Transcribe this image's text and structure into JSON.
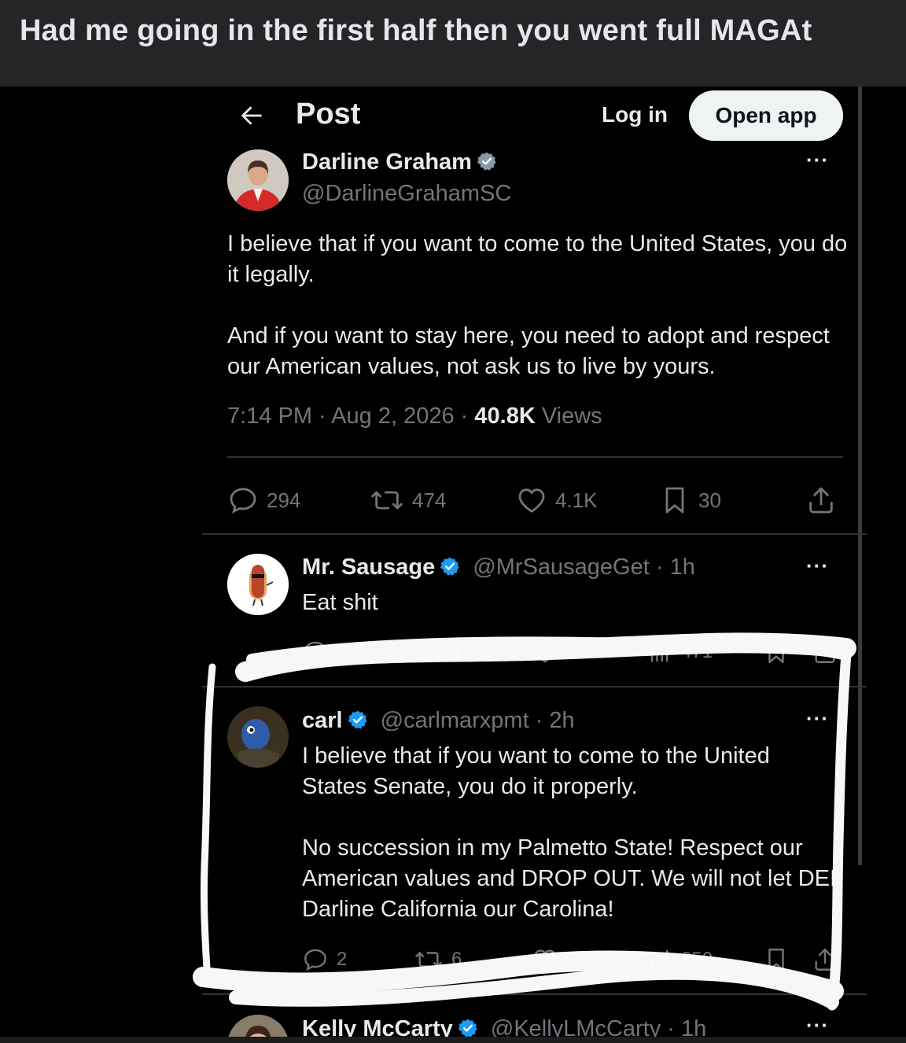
{
  "caption": "Had me going in the first half then you went full MAGAt",
  "header": {
    "title": "Post",
    "login_label": "Log in",
    "open_app_label": "Open app"
  },
  "main_post": {
    "name": "Darline Graham",
    "handle": "@DarlineGrahamSC",
    "paragraphs": [
      "I believe that if you want to come to the United States, you do it legally.",
      "And if you want to stay here, you need to adopt and respect our American values, not ask us to live by yours."
    ],
    "time": "7:14 PM",
    "date": "Aug 2, 2026",
    "views_count": "40.8K",
    "views_label": "Views",
    "replies": "294",
    "reposts": "474",
    "likes": "4.1K",
    "bookmarks": "30"
  },
  "replies": [
    {
      "name": "Mr. Sausage",
      "handle": "@MrSausageGet",
      "age": "1h",
      "paragraphs": [
        "Eat shit"
      ],
      "replies": "2",
      "reposts": "1",
      "likes": "65",
      "views": "471"
    },
    {
      "name": "carl",
      "handle": "@carlmarxpmt",
      "age": "2h",
      "paragraphs": [
        "I believe that if you want to come to the United States Senate, you do it properly.",
        "No succession in my Palmetto State! Respect our American values and DROP OUT. We will not let DEI Darline California our Carolina!"
      ],
      "replies": "2",
      "reposts": "6",
      "likes": "32",
      "views": "850"
    },
    {
      "name": "Kelly McCarty",
      "handle": "@KellyLMcCarty",
      "age": "1h"
    }
  ],
  "colors": {
    "verified": "#1d9bf0",
    "muted": "#71767b",
    "text": "#e7e9ea",
    "caption_bg": "#242526",
    "scribble": "#ffffff"
  }
}
